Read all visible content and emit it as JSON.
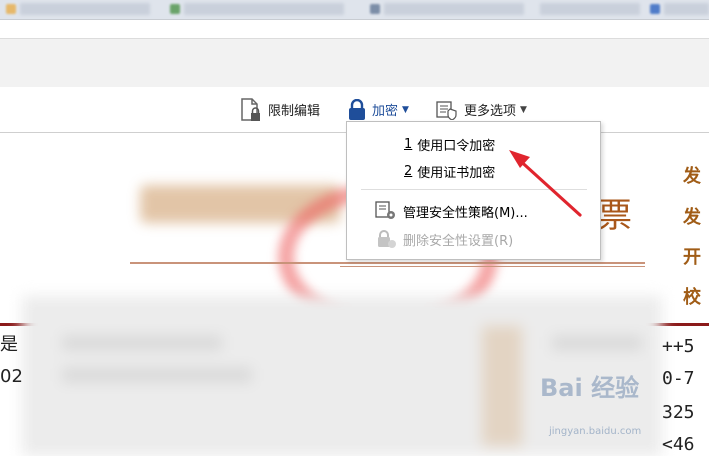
{
  "toolbar": {
    "restrict_edit": "限制编辑",
    "encrypt": "加密",
    "more_options": "更多选项"
  },
  "encrypt_menu": {
    "items": [
      {
        "accel": "1",
        "label": "使用口令加密",
        "enabled": true
      },
      {
        "accel": "2",
        "label": "使用证书加密",
        "enabled": true
      },
      {
        "label": "管理安全性策略(M)...",
        "enabled": true
      },
      {
        "label": "删除安全性设置(R)",
        "enabled": false
      }
    ]
  },
  "document": {
    "title_char": "票",
    "side_chars": [
      "发",
      "发",
      "开",
      "校"
    ],
    "left_chars": [
      "是",
      "02"
    ],
    "right_chars": [
      "++5",
      "0-7",
      "325",
      "<46"
    ]
  },
  "watermark": {
    "main": "Bai 经验",
    "sub": "jingyan.baidu.com"
  },
  "colors": {
    "accent": "#2457a8",
    "arrow": "#e0252e",
    "doc_brown": "#a05c16"
  }
}
